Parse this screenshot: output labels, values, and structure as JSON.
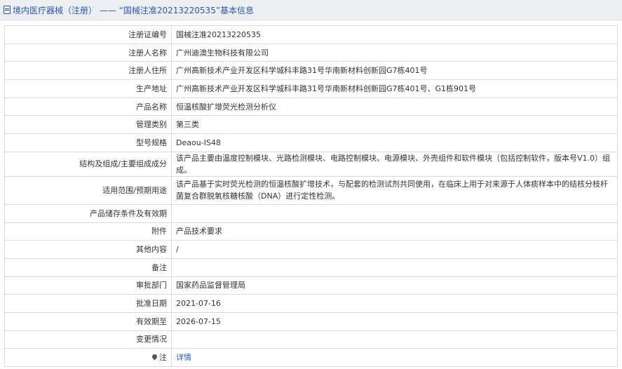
{
  "header": {
    "icon": "document-icon",
    "title": "境内医疗器械（注册） —— “国械注准20213220535”基本信息"
  },
  "rows": [
    {
      "label": "注册证编号",
      "value": "国械注准20213220535"
    },
    {
      "label": "注册人名称",
      "value": "广州迪澳生物科技有限公司"
    },
    {
      "label": "注册人住所",
      "value": "广州高新技术产业开发区科学城科丰路31号华南新材料创新园G7栋401号"
    },
    {
      "label": "生产地址",
      "value": "广州高新技术产业开发区科学城科丰路31号华南新材料创新园G7栋401号、G1栋901号"
    },
    {
      "label": "产品名称",
      "value": "恒温核酸扩增荧光检测分析仪"
    },
    {
      "label": "管理类别",
      "value": "第三类"
    },
    {
      "label": "型号规格",
      "value": "Deaou-IS48"
    },
    {
      "label": "结构及组成/主要组成成分",
      "value": "该产品主要由温度控制模块、光路检测模块、电路控制模块、电源模块、外壳组件和软件模块（包括控制软件，版本号V1.0）组成。"
    },
    {
      "label": "适用范围/预期用途",
      "value": "该产品基于实时荧光检测的恒温核酸扩增技术，与配套的检测试剂共同使用，在临床上用于对来源于人体痰样本中的结核分枝杆菌复合群脱氧核糖核酸（DNA）进行定性检测。"
    },
    {
      "label": "产品储存条件及有效期",
      "value": ""
    },
    {
      "label": "附件",
      "value": "产品技术要求"
    },
    {
      "label": "其他内容",
      "value": "/"
    },
    {
      "label": "备注",
      "value": ""
    },
    {
      "label": "审批部门",
      "value": "国家药品监督管理局"
    },
    {
      "label": "批准日期",
      "value": "2021-07-16"
    },
    {
      "label": "有效期至",
      "value": "2026-07-15"
    },
    {
      "label": "变更情况",
      "value": ""
    },
    {
      "label": "注",
      "value": "详情",
      "icon": "pin-icon"
    }
  ]
}
